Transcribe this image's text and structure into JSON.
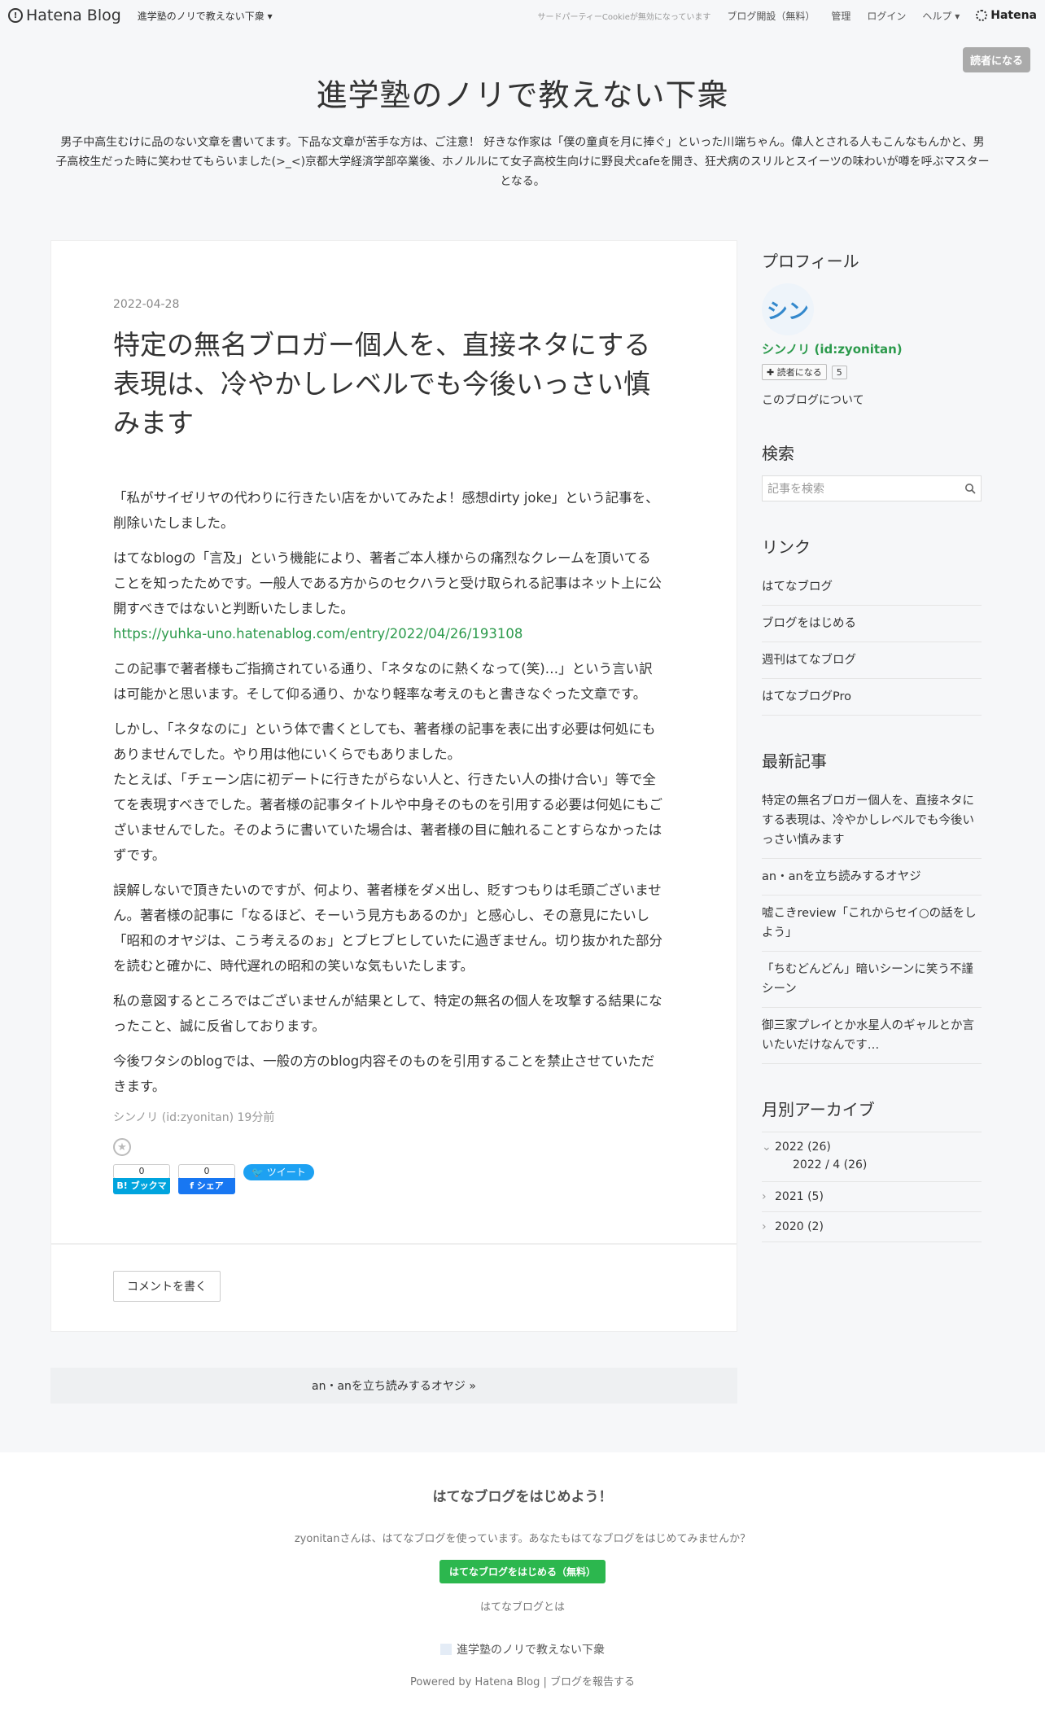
{
  "topbar": {
    "logo": "Hatena Blog",
    "blog_select": "進学塾のノリで教えない下衆 ▾",
    "cookie_notice": "サードパーティーCookieが無効になっています",
    "start_blog": "ブログ開設（無料）",
    "admin": "管理",
    "login": "ログイン",
    "help": "ヘルプ ▾",
    "hatena": "Hatena"
  },
  "header": {
    "subscribe": "読者になる",
    "title": "進学塾のノリで教えない下衆",
    "description": "男子中高生むけに品のない文章を書いてます。下品な文章が苦手な方は、ご注意！ 好きな作家は「僕の童貞を月に捧ぐ」といった川端ちゃん。偉人とされる人もこんなもんかと、男子高校生だった時に笑わせてもらいました(>_<)京都大学経済学部卒業後、ホノルルにて女子高校生向けに野良犬cafeを開き、狂犬病のスリルとスイーツの味わいが噂を呼ぶマスターとなる。"
  },
  "entry": {
    "date": "2022-04-28",
    "title": "特定の無名ブロガー個人を、直接ネタにする表現は、冷やかしレベルでも今後いっさい慎みます",
    "p1": "「私がサイゼリヤの代わりに行きたい店をかいてみたよ！感想dirty joke」という記事を、削除いたしました。",
    "p2": "はてなblogの「言及」という機能により、著者ご本人様からの痛烈なクレームを頂いてることを知ったためです。一般人である方からのセクハラと受け取られる記事はネット上に公開すべきではないと判断いたしました。",
    "p2_link": "https://yuhka-uno.hatenablog.com/entry/2022/04/26/193108",
    "p3": "この記事で著者様もご指摘されている通り、「ネタなのに熱くなって(笑)…」という言い訳は可能かと思います。そして仰る通り、かなり軽率な考えのもと書きなぐった文章です。",
    "p4a": "しかし、「ネタなのに」という体で書くとしても、著者様の記事を表に出す必要は何処にもありませんでした。やり用は他にいくらでもありました。",
    "p4b": "たとえば、「チェーン店に初デートに行きたがらない人と、行きたい人の掛け合い」等で全てを表現すべきでした。著者様の記事タイトルや中身そのものを引用する必要は何処にもございませんでした。そのように書いていた場合は、著者様の目に触れることすらなかったはずです。",
    "p5": "誤解しないで頂きたいのですが、何より、著者様をダメ出し、貶すつもりは毛頭ございません。著者様の記事に「なるほど、そーいう見方もあるのか」と感心し、その意見にたいし「昭和のオヤジは、こう考えるのぉ」とブヒブヒしていたに過ぎません。切り抜かれた部分を読むと確かに、時代遅れの昭和の笑いな気もいたします。",
    "p6": "私の意図するところではございませんが結果として、特定の無名の個人を攻撃する結果になったこと、誠に反省しております。",
    "p7": "今後ワタシのblogでは、一般の方のblog内容そのものを引用することを禁止させていただきます。",
    "author": "シンノリ (id:zyonitan) 19分前",
    "share": {
      "hatena_count": "0",
      "hatena_label": "B! ブックマーク",
      "fb_count": "0",
      "fb_label": "f シェア",
      "tweet": "ツイート"
    },
    "comment_button": "コメントを書く"
  },
  "pager": {
    "next": "an・anを立ち読みするオヤジ »"
  },
  "sidebar": {
    "profile": {
      "title": "プロフィール",
      "avatar_text": "シン",
      "name": "シンノリ (id:zyonitan)",
      "subscribe": "✚ 読者になる",
      "count": "5",
      "about": "このブログについて"
    },
    "search": {
      "title": "検索",
      "placeholder": "記事を検索"
    },
    "links": {
      "title": "リンク",
      "items": [
        "はてなブログ",
        "ブログをはじめる",
        "週刊はてなブログ",
        "はてなブログPro"
      ]
    },
    "recent": {
      "title": "最新記事",
      "items": [
        "特定の無名ブロガー個人を、直接ネタにする表現は、冷やかしレベルでも今後いっさい慎みます",
        "an・anを立ち読みするオヤジ",
        "嘘こきreview「これからセイ○の話をしよう」",
        "「ちむどんどん」暗いシーンに笑う不謹シーン",
        "御三家プレイとか水星人のギャルとか言いたいだけなんです…"
      ]
    },
    "archive": {
      "title": "月別アーカイブ",
      "y2022": "2022 (26)",
      "y2022_04": "2022 / 4 (26)",
      "y2021": "2021 (5)",
      "y2020": "2020 (2)"
    }
  },
  "footer": {
    "title": "はてなブログをはじめよう！",
    "text": "zyonitanさんは、はてなブログを使っています。あなたもはてなブログをはじめてみませんか？",
    "start_button": "はてなブログをはじめる（無料）",
    "about": "はてなブログとは",
    "blog_name": "進学塾のノリで教えない下衆",
    "powered": "Powered by Hatena Blog | ブログを報告する"
  }
}
